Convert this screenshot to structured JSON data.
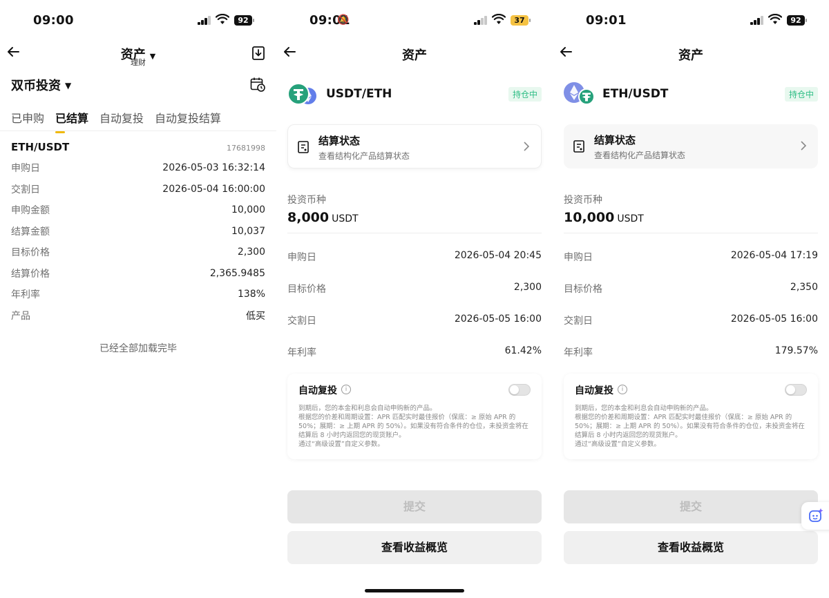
{
  "panel1": {
    "status": {
      "time": "09:00",
      "battery": "92"
    },
    "nav": {
      "title": "资产",
      "subtitle": "理财"
    },
    "section_title": "双币投资",
    "tabs": [
      "已申购",
      "已结算",
      "自动复投",
      "自动复投结算"
    ],
    "active_tab": 1,
    "card": {
      "pair": "ETH/USDT",
      "id": "17681998",
      "rows": [
        {
          "label": "申购日",
          "value": "2026-05-03 16:32:14"
        },
        {
          "label": "交割日",
          "value": "2026-05-04 16:00:00"
        },
        {
          "label": "申购金额",
          "value": "10,000"
        },
        {
          "label": "结算金额",
          "value": "10,037"
        },
        {
          "label": "目标价格",
          "value": "2,300"
        },
        {
          "label": "结算价格",
          "value": "2,365.9485"
        },
        {
          "label": "年利率",
          "value": "138%"
        },
        {
          "label": "产品",
          "value": "低买"
        }
      ]
    },
    "loaded_text": "已经全部加载完毕"
  },
  "panel2": {
    "status": {
      "time": "09:01",
      "battery": "37"
    },
    "nav": {
      "title": "资产"
    },
    "pair": "USDT/ETH",
    "badge": "持仓中",
    "settle": {
      "title": "结算状态",
      "desc": "查看结构化产品结算状态"
    },
    "invest_label": "投资币种",
    "invest_amount": "8,000",
    "invest_unit": "USDT",
    "rows": [
      {
        "label": "申购日",
        "value": "2026-05-04 20:45"
      },
      {
        "label": "目标价格",
        "value": "2,300"
      },
      {
        "label": "交割日",
        "value": "2026-05-05 16:00"
      },
      {
        "label": "年利率",
        "value": "61.42%"
      }
    ],
    "auto": {
      "title": "自动复投",
      "desc": "到期后，您的本金和利息会自动申购新的产品。\n根据您的价差和周期设置：APR 匹配实时最佳报价（保底：≥ 原始 APR 的 50%；展期：≥ 上期 APR 的 50%）。如果没有符合条件的仓位，未投资金将在结算后 8 小时内返回您的现货账户。\n通过“高级设置”自定义参数。"
    },
    "submit_label": "提交",
    "overview_label": "查看收益概览"
  },
  "panel3": {
    "status": {
      "time": "09:01",
      "battery": "92"
    },
    "nav": {
      "title": "资产"
    },
    "pair": "ETH/USDT",
    "badge": "持仓中",
    "settle": {
      "title": "结算状态",
      "desc": "查看结构化产品结算状态"
    },
    "invest_label": "投资币种",
    "invest_amount": "10,000",
    "invest_unit": "USDT",
    "rows": [
      {
        "label": "申购日",
        "value": "2026-05-04 17:19"
      },
      {
        "label": "目标价格",
        "value": "2,350"
      },
      {
        "label": "交割日",
        "value": "2026-05-05 16:00"
      },
      {
        "label": "年利率",
        "value": "179.57%"
      }
    ],
    "auto": {
      "title": "自动复投",
      "desc": "到期后，您的本金和利息会自动申购新的产品。\n根据您的价差和周期设置：APR 匹配实时最佳报价（保底：≥ 原始 APR 的 50%；展期：≥ 上期 APR 的 50%）。如果没有符合条件的仓位，未投资金将在结算后 8 小时内返回您的现货账户。\n通过“高级设置”自定义参数。"
    },
    "submit_label": "提交",
    "overview_label": "查看收益概览"
  },
  "colors": {
    "accent": "#f0b90b",
    "badge_green": "#2ebd85",
    "usdt_teal": "#26a17b",
    "eth_purple": "#627eea"
  }
}
